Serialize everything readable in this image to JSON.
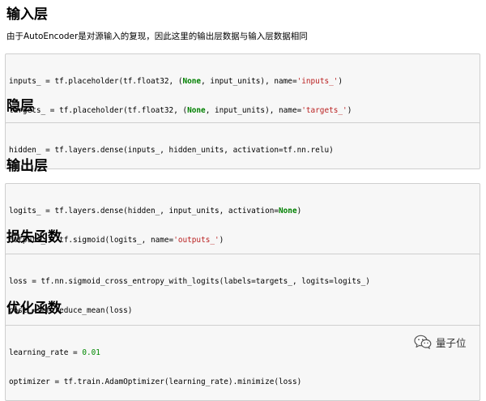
{
  "sections": {
    "input": {
      "title": "输入层",
      "description": "由于AutoEncoder是对源输入的复现，因此这里的输出层数据与输入层数据相同",
      "code": [
        [
          "inputs_ = tf.placeholder(tf.float32, (",
          "None",
          ", input_units), name=",
          "'inputs_'",
          ")"
        ],
        [
          "targets_ = tf.placeholder(tf.float32, (",
          "None",
          ", input_units), name=",
          "'targets_'",
          ")"
        ]
      ]
    },
    "hidden": {
      "title": "隐层",
      "code": [
        [
          "hidden_ = tf.layers.dense(inputs_, hidden_units, activation=tf.nn.relu)"
        ]
      ]
    },
    "output": {
      "title": "输出层",
      "code": [
        [
          "logits_ = tf.layers.dense(hidden_, input_units, activation=",
          "None",
          ")"
        ],
        [
          "outputs_ = tf.sigmoid(logits_, name=",
          "'outputs_'",
          ")"
        ]
      ]
    },
    "loss": {
      "title": "损失函数",
      "code": [
        [
          "loss = tf.nn.sigmoid_cross_entropy_with_logits(labels=targets_, logits=logits_)"
        ],
        [
          "cost = tf.reduce_mean(loss)"
        ]
      ]
    },
    "optimizer": {
      "title": "优化函数",
      "code": [
        [
          "learning_rate = ",
          "0.01"
        ],
        [
          "optimizer = tf.train.AdamOptimizer(learning_rate).minimize(loss)"
        ]
      ]
    }
  },
  "watermark": {
    "text": "量子位",
    "icon": "wechat-icon"
  },
  "colors": {
    "keyword": "#008000",
    "string": "#ba2121",
    "number": "#008800",
    "code_bg": "#f7f7f7",
    "code_border": "#cfcfcf"
  }
}
